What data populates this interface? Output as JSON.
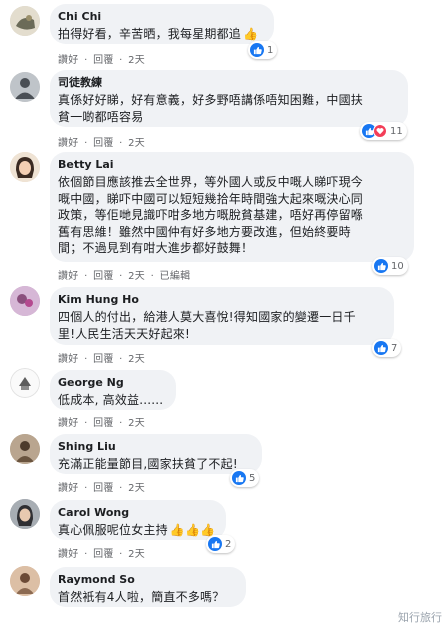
{
  "actions": {
    "like": "讚好",
    "sep": "·",
    "reply": "回覆",
    "age": "2天",
    "edited": "已編輯"
  },
  "comments": [
    {
      "name": "Chi Chi",
      "lines": [
        "拍得好看，辛苦晒，我每星期都追"
      ],
      "reaction_count": "1",
      "emoji": "👍"
    },
    {
      "name": "司徒教練",
      "lines": [
        "真係好好睇，好有意義，好多野唔講係唔知困難，中國扶",
        "貧一啲都唔容易"
      ],
      "reaction_count": "11"
    },
    {
      "name": "Betty Lai",
      "lines": [
        "依個節目應該推去全世界，等外國人或反中嘅人睇吓現今",
        "嘅中國，睇吓中國可以短短幾拾年時間強大起來嘅決心同",
        "政策，等佢哋見識吓咁多地方嘅脫貧基建，唔好再停留喺",
        "舊有思維！雖然中國仲有好多地方要改進，但始終要時",
        "間；不過見到有咁大進步都好鼓舞！"
      ],
      "reaction_count": "10"
    },
    {
      "name": "Kim Hung Ho",
      "lines": [
        "四個人的付出，給港人莫大喜悅!得知國家的變遷一日千",
        "里!人民生活天天好起來!"
      ],
      "reaction_count": "7"
    },
    {
      "name": "George Ng",
      "lines": [
        "低成本, 高效益......"
      ]
    },
    {
      "name": "Shing Liu",
      "lines": [
        "充滿正能量節目,國家扶貧了不起!"
      ],
      "reaction_count": "5"
    },
    {
      "name": "Carol Wong",
      "lines": [
        "真心佩服呢位女主持"
      ],
      "reaction_count": "2",
      "emoji": "👍👍👍"
    },
    {
      "name": "Raymond So",
      "lines": [
        "首然衹有4人啦，簡直不多嗎？"
      ]
    }
  ],
  "watermark": "知行旅行",
  "colors": {
    "bubble": "#f0f2f5",
    "like_blue": "#1877f2",
    "love_red": "#f33e58",
    "meta_gray": "#65676b"
  },
  "icons": [
    "like-icon",
    "love-icon",
    "thumbs-up-emoji",
    "user-avatar"
  ]
}
